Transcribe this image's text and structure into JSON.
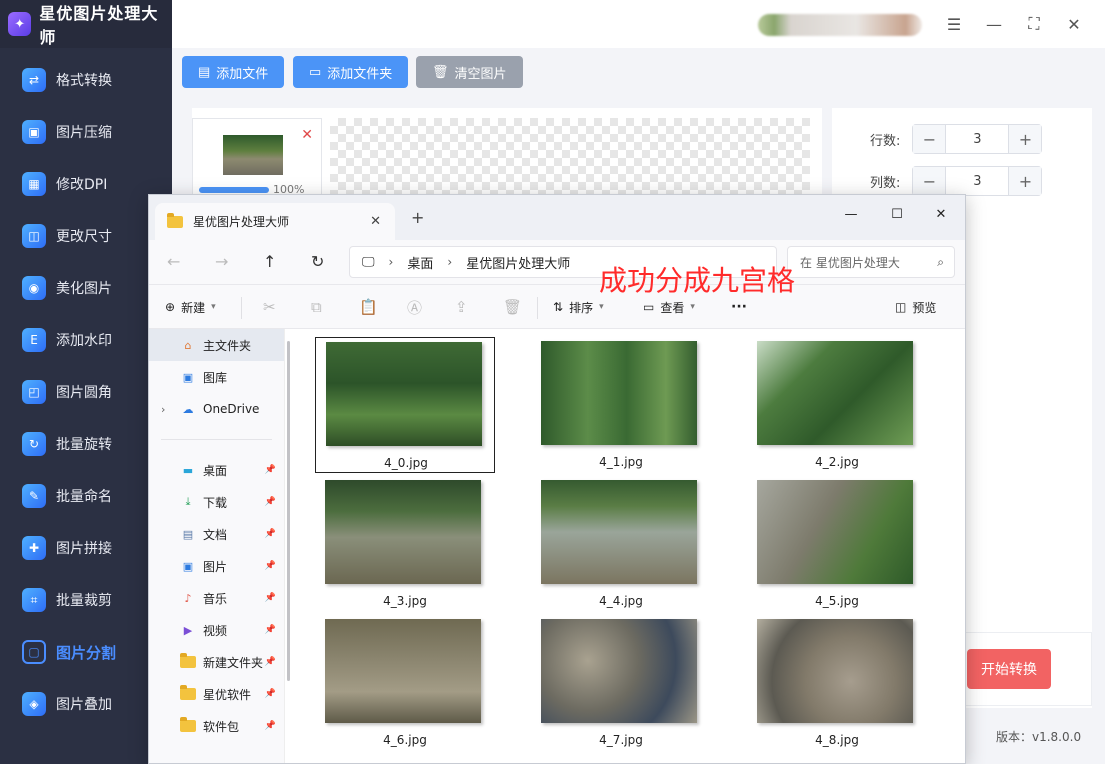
{
  "app": {
    "title": "星优图片处理大师",
    "nav": [
      {
        "label": "格式转换",
        "icon": "format-convert-icon"
      },
      {
        "label": "图片压缩",
        "icon": "compress-icon"
      },
      {
        "label": "修改DPI",
        "icon": "dpi-icon"
      },
      {
        "label": "更改尺寸",
        "icon": "resize-icon"
      },
      {
        "label": "美化图片",
        "icon": "beautify-icon"
      },
      {
        "label": "添加水印",
        "icon": "watermark-icon"
      },
      {
        "label": "图片圆角",
        "icon": "round-corner-icon"
      },
      {
        "label": "批量旋转",
        "icon": "rotate-icon"
      },
      {
        "label": "批量命名",
        "icon": "rename-icon"
      },
      {
        "label": "图片拼接",
        "icon": "stitch-icon"
      },
      {
        "label": "批量裁剪",
        "icon": "crop-icon"
      },
      {
        "label": "图片分割",
        "icon": "split-icon",
        "active": true
      },
      {
        "label": "图片叠加",
        "icon": "overlay-icon"
      }
    ],
    "toolbar": {
      "add_file": "添加文件",
      "add_folder": "添加文件夹",
      "clear": "清空图片"
    },
    "thumb_progress": "100%",
    "rows_label": "行数:",
    "rows_value": "3",
    "cols_label": "列数:",
    "cols_value": "3",
    "start_button": "开始转换",
    "version": "版本：v1.8.0.0"
  },
  "explorer": {
    "tab_title": "星优图片处理大师",
    "breadcrumb": [
      "桌面",
      "星优图片处理大师"
    ],
    "search_placeholder": "在 星优图片处理大",
    "annotation": "成功分成九宫格",
    "commands": {
      "new": "新建",
      "sort": "排序",
      "view": "查看",
      "more": "···",
      "preview": "预览"
    },
    "sidebar": [
      {
        "label": "主文件夹",
        "icon": "home-icon",
        "selected": true
      },
      {
        "label": "图库",
        "icon": "gallery-icon"
      },
      {
        "label": "OneDrive",
        "icon": "onedrive-icon"
      },
      {
        "label": "桌面",
        "icon": "desktop-icon"
      },
      {
        "label": "下载",
        "icon": "download-icon"
      },
      {
        "label": "文档",
        "icon": "documents-icon"
      },
      {
        "label": "图片",
        "icon": "pictures-icon"
      },
      {
        "label": "音乐",
        "icon": "music-icon"
      },
      {
        "label": "视频",
        "icon": "videos-icon"
      },
      {
        "label": "新建文件夹",
        "icon": "folder-icon"
      },
      {
        "label": "星优软件",
        "icon": "folder-icon"
      },
      {
        "label": "软件包",
        "icon": "folder-icon"
      }
    ],
    "files": [
      "4_0.jpg",
      "4_1.jpg",
      "4_2.jpg",
      "4_3.jpg",
      "4_4.jpg",
      "4_5.jpg",
      "4_6.jpg",
      "4_7.jpg",
      "4_8.jpg"
    ]
  }
}
